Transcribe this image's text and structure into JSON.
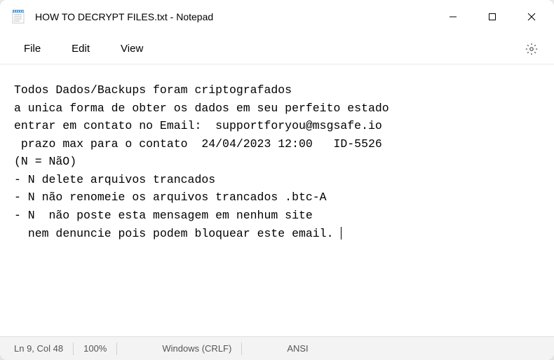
{
  "titlebar": {
    "title": "HOW TO DECRYPT FILES.txt - Notepad"
  },
  "menubar": {
    "file": "File",
    "edit": "Edit",
    "view": "View"
  },
  "content": {
    "line1": "Todos Dados/Backups foram criptografados",
    "line2": "a unica forma de obter os dados em seu perfeito estado ",
    "line3": "entrar em contato no Email:  supportforyou@msgsafe.io",
    "line4": " prazo max para o contato  24/04/2023 12:00   ID-5526",
    "line5": "(N = NãO)",
    "line6": "- N delete arquivos trancados",
    "line7": "- N não renomeie os arquivos trancados .btc-A",
    "line8": "- N  não poste esta mensagem em nenhum site",
    "line9": "  nem denuncie pois podem bloquear este email. "
  },
  "statusbar": {
    "position": "Ln 9, Col 48",
    "zoom": "100%",
    "lineending": "Windows (CRLF)",
    "encoding": "ANSI"
  }
}
